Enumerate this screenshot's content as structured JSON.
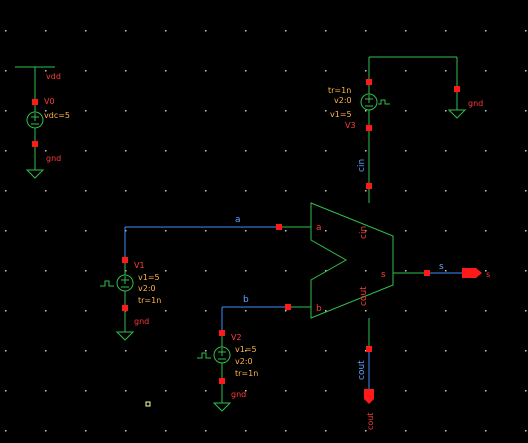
{
  "labels": {
    "vdd_net": "vdd",
    "v0_name": "V0",
    "v0_param": "vdc=5",
    "gnd1": "gnd",
    "v3_tr": "tr=1n",
    "v3_v2": "v2:0",
    "v3_v1": "v1=5",
    "v3_name": "V3",
    "gnd_v3": "gnd",
    "cin_wire": "cin",
    "a_wire": "a",
    "v1_name": "V1",
    "v1_v1": "v1=5",
    "v1_v2": "v2:0",
    "v1_tr": "tr=1n",
    "gnd_v1": "gnd",
    "b_wire": "b",
    "v2_name": "V2",
    "v2_v1": "v1=5",
    "v2_v2": "v2:0",
    "v2_tr": "tr=1n",
    "gnd_v2": "gnd",
    "pin_a": "a",
    "pin_b": "b",
    "pin_cin": "cin",
    "pin_cout": "cout",
    "pin_s": "s",
    "s_wire": "s",
    "s_out": "s",
    "cout_wire": "cout",
    "cout_out": "cout"
  },
  "colors": {
    "background": "#000000",
    "wire_green": "#2fbf4a",
    "wire_blue": "#3f8cff",
    "pin_red": "#ff1a1a",
    "label_red": "#ff3b3b",
    "label_orange": "#ffb347"
  }
}
